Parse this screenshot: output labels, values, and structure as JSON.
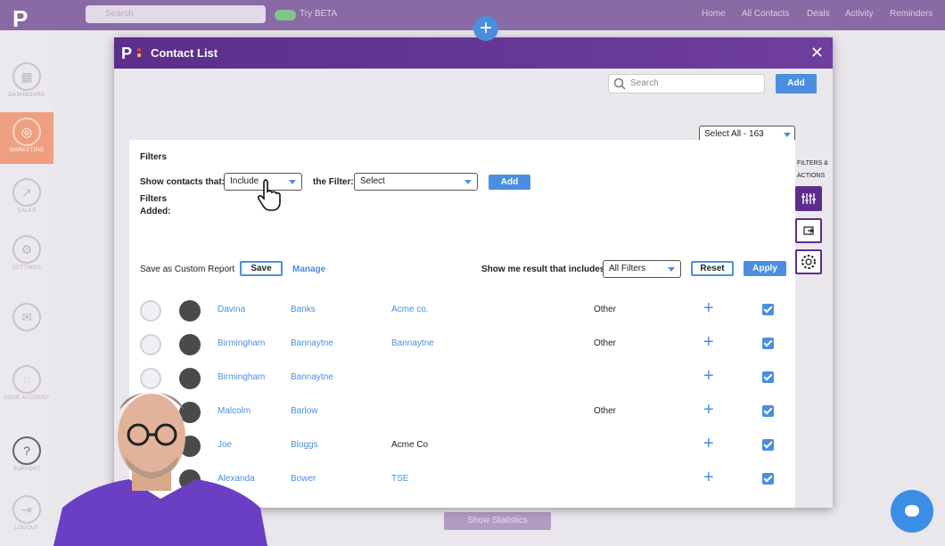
{
  "background": {
    "search_placeholder": "Search",
    "beta_label": "Try BETA",
    "nav": [
      "Home",
      "All Contacts",
      "Deals",
      "Activity",
      "Reminders"
    ],
    "sidebar": [
      "DASHBOARD",
      "MARKETING",
      "SALES",
      "SETTINGS",
      "",
      "YOUR ACCOUNT",
      "SUPPORT",
      "LOGOUT"
    ],
    "show_statistics": "Show Statistics"
  },
  "modal": {
    "title": "Contact List",
    "search_placeholder": "Search",
    "add_label": "Add",
    "select_all": "Select All - 163",
    "filters_actions": "FILTERS & ACTIONS"
  },
  "filters": {
    "title": "Filters",
    "show_contacts_label": "Show contacts that:",
    "include_value": "Include",
    "the_filter_label": "the Filter:",
    "filter_value": "Select",
    "add_label": "Add",
    "filters_added_label": "Filters Added:",
    "save_custom_label": "Save as Custom Report",
    "save_label": "Save",
    "manage_label": "Manage",
    "show_result_label": "Show me result that includes",
    "result_value": "All Filters",
    "reset_label": "Reset",
    "apply_label": "Apply"
  },
  "contacts": [
    {
      "first": "Davina",
      "last": "Banks",
      "company": "Acme co.",
      "company_link": true,
      "type": "Other"
    },
    {
      "first": "Birmingham",
      "last": "Bannaytne",
      "company": "Bannaytne",
      "company_link": true,
      "type": "Other"
    },
    {
      "first": "Birmingham",
      "last": "Bannaytne",
      "company": "",
      "company_link": true,
      "type": ""
    },
    {
      "first": "Malcolm",
      "last": "Barlow",
      "company": "",
      "company_link": true,
      "type": "Other"
    },
    {
      "first": "Joe",
      "last": "Bloggs",
      "company": "Acme Co",
      "company_link": false,
      "type": ""
    },
    {
      "first": "Alexanda",
      "last": "Bower",
      "company": "TSE",
      "company_link": true,
      "type": ""
    }
  ],
  "colors": {
    "accent": "#4a8fdf",
    "brand_purple": "#5c2e8a",
    "marketing_active": "#ee9f80"
  }
}
